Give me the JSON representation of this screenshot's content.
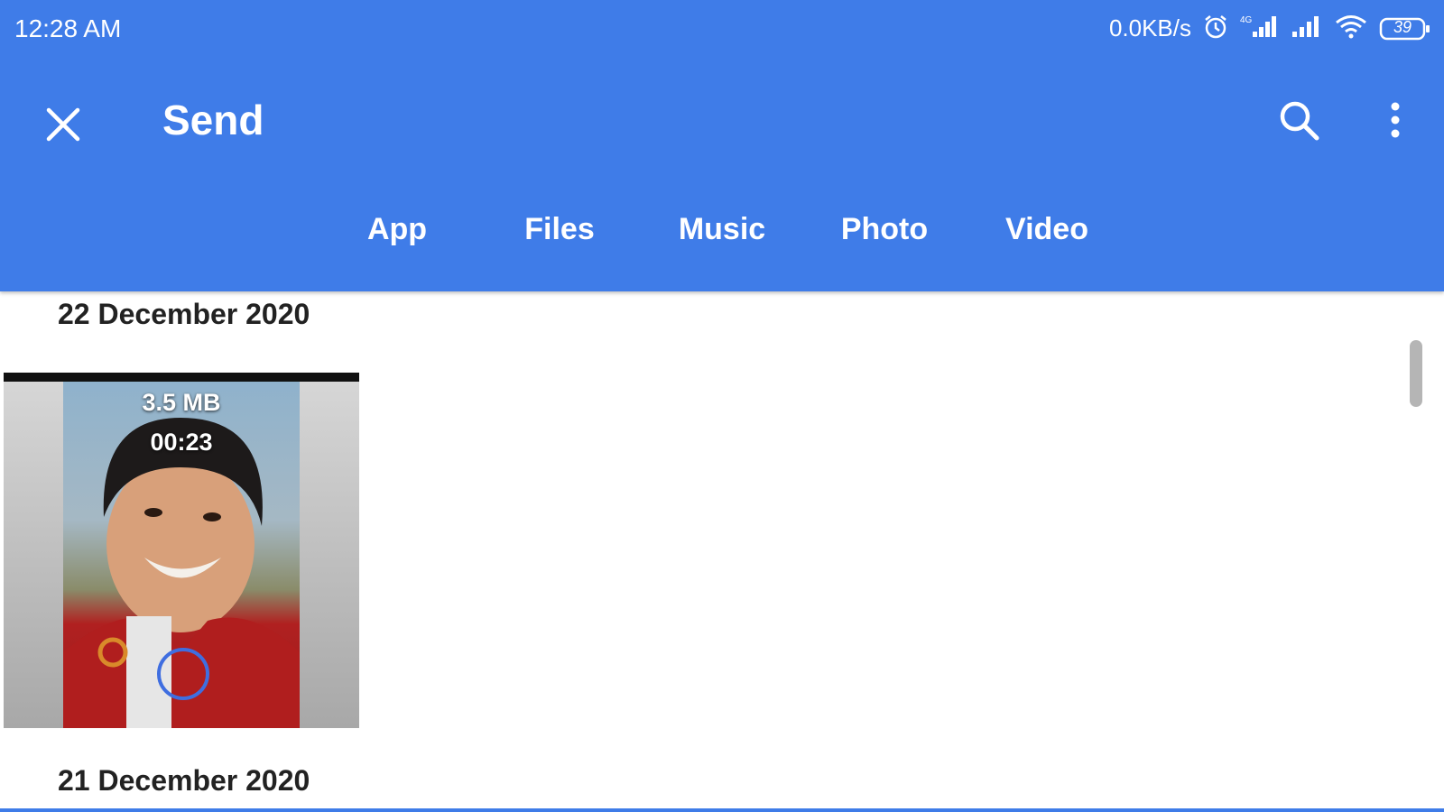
{
  "status_bar": {
    "time": "12:28 AM",
    "net_speed": "0.0KB/s",
    "battery": "39",
    "icons": [
      "alarm-icon",
      "signal-4g-icon",
      "signal-icon",
      "wifi-icon",
      "battery-icon"
    ]
  },
  "toolbar": {
    "title": "Send",
    "close_icon": "close-icon",
    "search_icon": "search-icon",
    "more_icon": "more-vert-icon"
  },
  "tabs": [
    {
      "label": "App"
    },
    {
      "label": "Files"
    },
    {
      "label": "Music"
    },
    {
      "label": "Photo"
    },
    {
      "label": "Video"
    }
  ],
  "sections": [
    {
      "date": "22 December 2020",
      "items": [
        {
          "size": "3.5 MB",
          "duration": "00:23"
        }
      ]
    },
    {
      "date": "21 December 2020",
      "items": []
    }
  ],
  "colors": {
    "accent": "#3f7ce8",
    "select_ring": "#3f6ee0"
  }
}
